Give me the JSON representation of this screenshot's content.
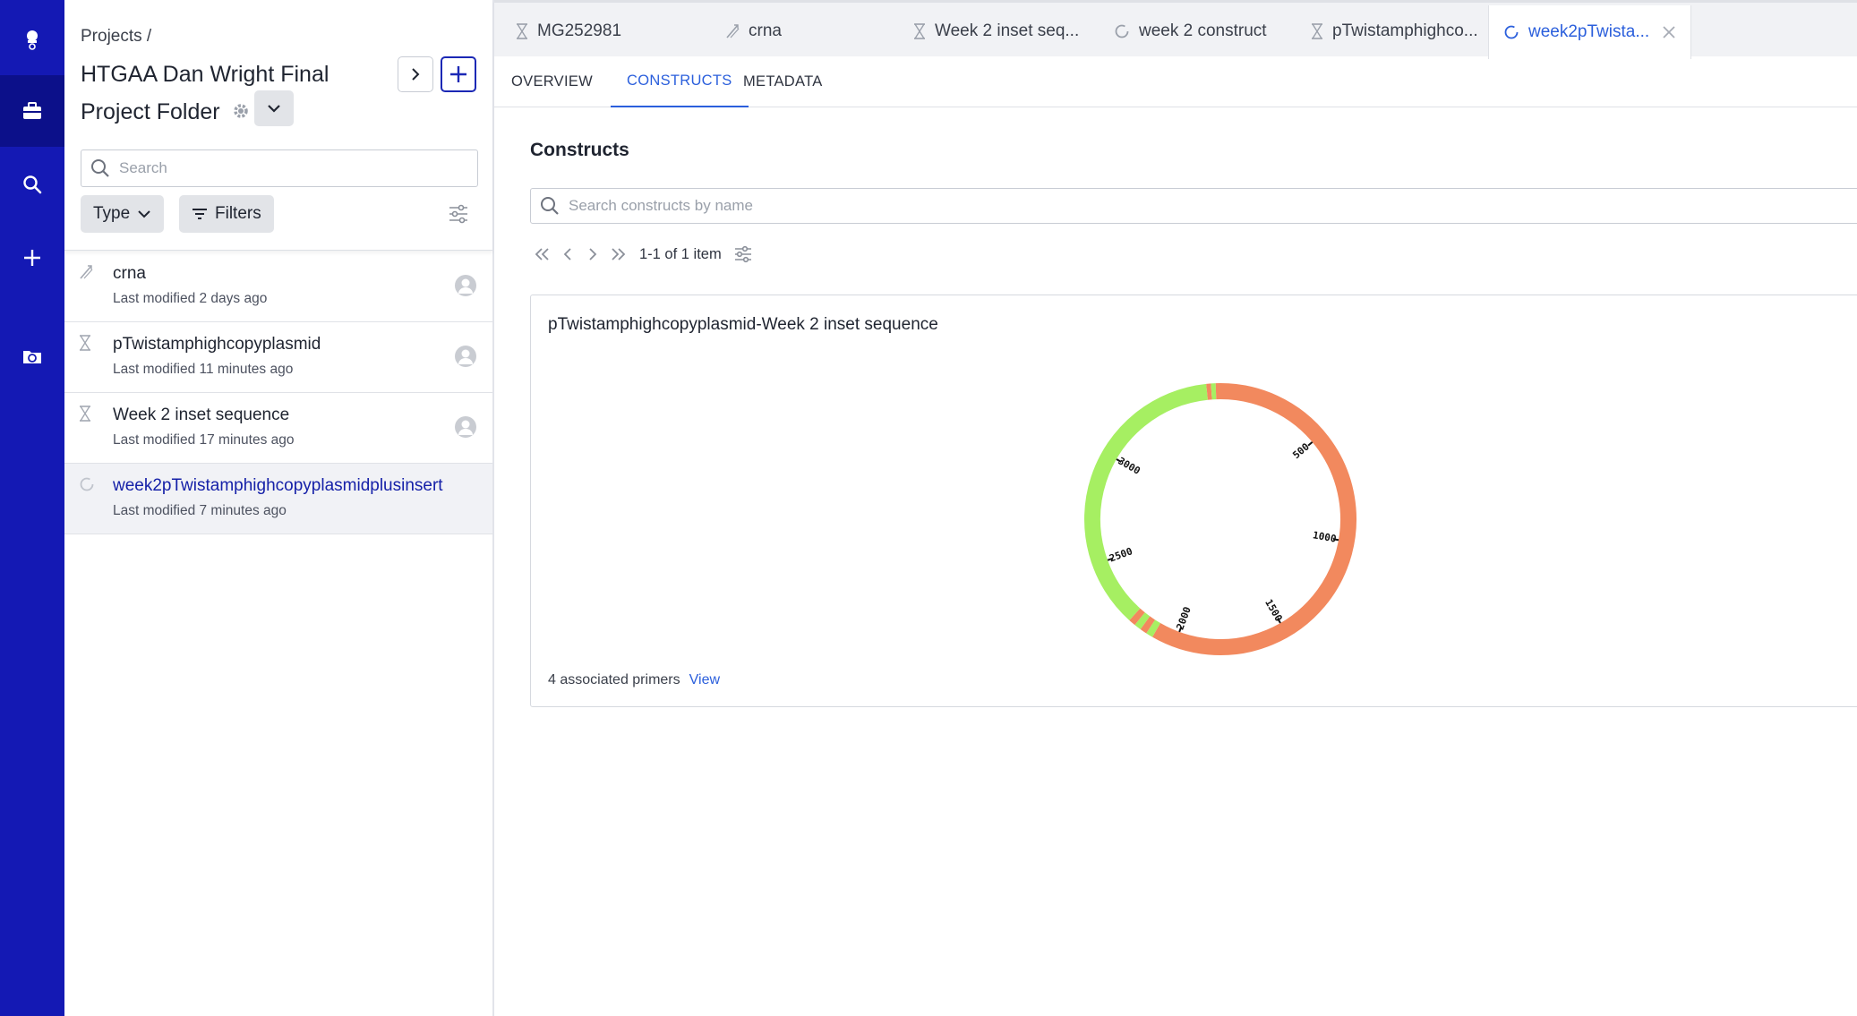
{
  "rail": {
    "items": [
      {
        "name": "logo",
        "icon": "lab-logo-icon"
      },
      {
        "name": "projects",
        "icon": "briefcase-icon",
        "active": true
      },
      {
        "name": "search",
        "icon": "search-icon"
      },
      {
        "name": "create",
        "icon": "plus-icon"
      },
      {
        "name": "sync",
        "icon": "folder-sync-icon"
      }
    ]
  },
  "project": {
    "breadcrumb": "Projects /",
    "title": "HTGAA Dan Wright Final Project Folder",
    "search_placeholder": "Search",
    "type_label": "Type",
    "filters_label": "Filters",
    "items": [
      {
        "name": "crna",
        "meta": "Last modified 2 days ago",
        "icon": "primer-icon",
        "selected": false,
        "avatar": true
      },
      {
        "name": "pTwistamphighcopyplasmid",
        "meta": "Last modified 11 minutes ago",
        "icon": "hourglass-icon",
        "selected": false,
        "avatar": true
      },
      {
        "name": "Week 2 inset sequence",
        "meta": "Last modified 17 minutes ago",
        "icon": "hourglass-icon",
        "selected": false,
        "avatar": true
      },
      {
        "name": "week2pTwistamphighcopyplasmidplusinsert",
        "meta": "Last modified 7 minutes ago",
        "icon": "circle-loading-icon",
        "selected": true,
        "avatar": false
      }
    ]
  },
  "file_tabs": [
    {
      "label": "MG252981",
      "icon": "hourglass-icon"
    },
    {
      "label": "crna",
      "icon": "primer-icon"
    },
    {
      "label": "Week 2 inset seq...",
      "icon": "hourglass-icon"
    },
    {
      "label": "week 2 construct",
      "icon": "circle-loading-icon"
    },
    {
      "label": "pTwistamphighco...",
      "icon": "hourglass-icon"
    },
    {
      "label": "week2pTwista...",
      "icon": "circle-loading-icon",
      "active": true
    }
  ],
  "sub_tabs": [
    {
      "label": "OVERVIEW"
    },
    {
      "label": "CONSTRUCTS",
      "active": true
    },
    {
      "label": "METADATA"
    }
  ],
  "constructs": {
    "title": "Constructs",
    "search_placeholder": "Search constructs by name",
    "pager_text": "1-1 of 1 item",
    "card": {
      "title": "pTwistamphighcopyplasmid-Week 2 inset sequence",
      "primers_text": "4 associated primers",
      "view_label": "View",
      "plasmid": {
        "total_bp": 3600,
        "ticks": [
          "500",
          "1000",
          "1500",
          "2000",
          "2500",
          "3000"
        ],
        "colors": {
          "backbone": "#f2895e",
          "insert": "#a6ef62"
        }
      }
    }
  },
  "colors": {
    "rail": "#1419b4",
    "rail_active": "#0c108a",
    "accent": "#2b5fdc"
  }
}
